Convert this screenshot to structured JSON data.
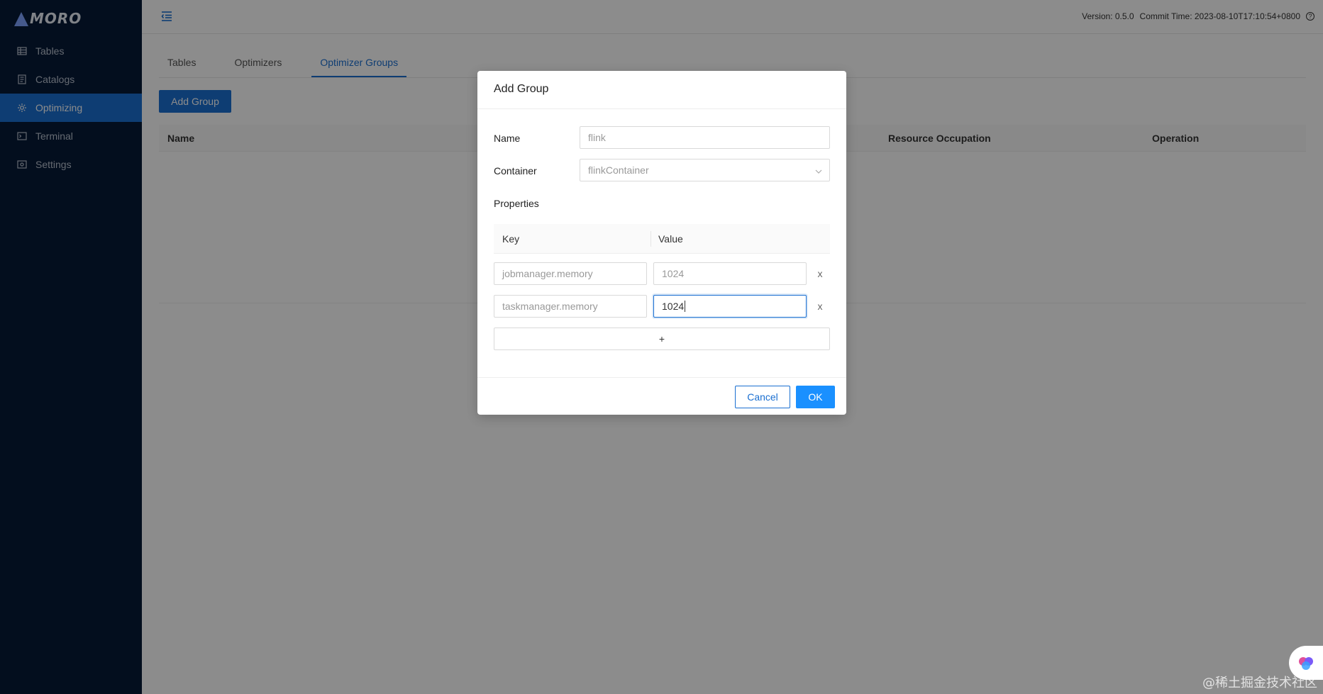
{
  "app": {
    "logo": "MORO"
  },
  "sidebar": {
    "items": [
      {
        "label": "Tables",
        "icon": "table-icon",
        "active": false
      },
      {
        "label": "Catalogs",
        "icon": "catalog-icon",
        "active": false
      },
      {
        "label": "Optimizing",
        "icon": "optimizing-icon",
        "active": true
      },
      {
        "label": "Terminal",
        "icon": "terminal-icon",
        "active": false
      },
      {
        "label": "Settings",
        "icon": "settings-icon",
        "active": false
      }
    ]
  },
  "header": {
    "version": "Version: 0.5.0",
    "commit_time": "Commit Time: 2023-08-10T17:10:54+0800"
  },
  "main": {
    "tabs": [
      {
        "label": "Tables",
        "active": false
      },
      {
        "label": "Optimizers",
        "active": false
      },
      {
        "label": "Optimizer Groups",
        "active": true
      }
    ],
    "add_group_label": "Add Group",
    "table_headers": {
      "name": "Name",
      "resource_occupation": "Resource Occupation",
      "operation": "Operation"
    }
  },
  "modal": {
    "title": "Add Group",
    "name_label": "Name",
    "name_value": "flink",
    "container_label": "Container",
    "container_value": "flinkContainer",
    "properties_label": "Properties",
    "key_header": "Key",
    "value_header": "Value",
    "properties": [
      {
        "key": "jobmanager.memory",
        "value": "1024"
      },
      {
        "key": "taskmanager.memory",
        "value": "1024"
      }
    ],
    "remove_symbol": "x",
    "add_symbol": "+",
    "cancel_label": "Cancel",
    "ok_label": "OK"
  },
  "watermark": "@稀土掘金技术社区",
  "colors": {
    "sidebar_bg": "#061a37",
    "accent": "#1a6fd1",
    "primary_button": "#1a90ff"
  }
}
